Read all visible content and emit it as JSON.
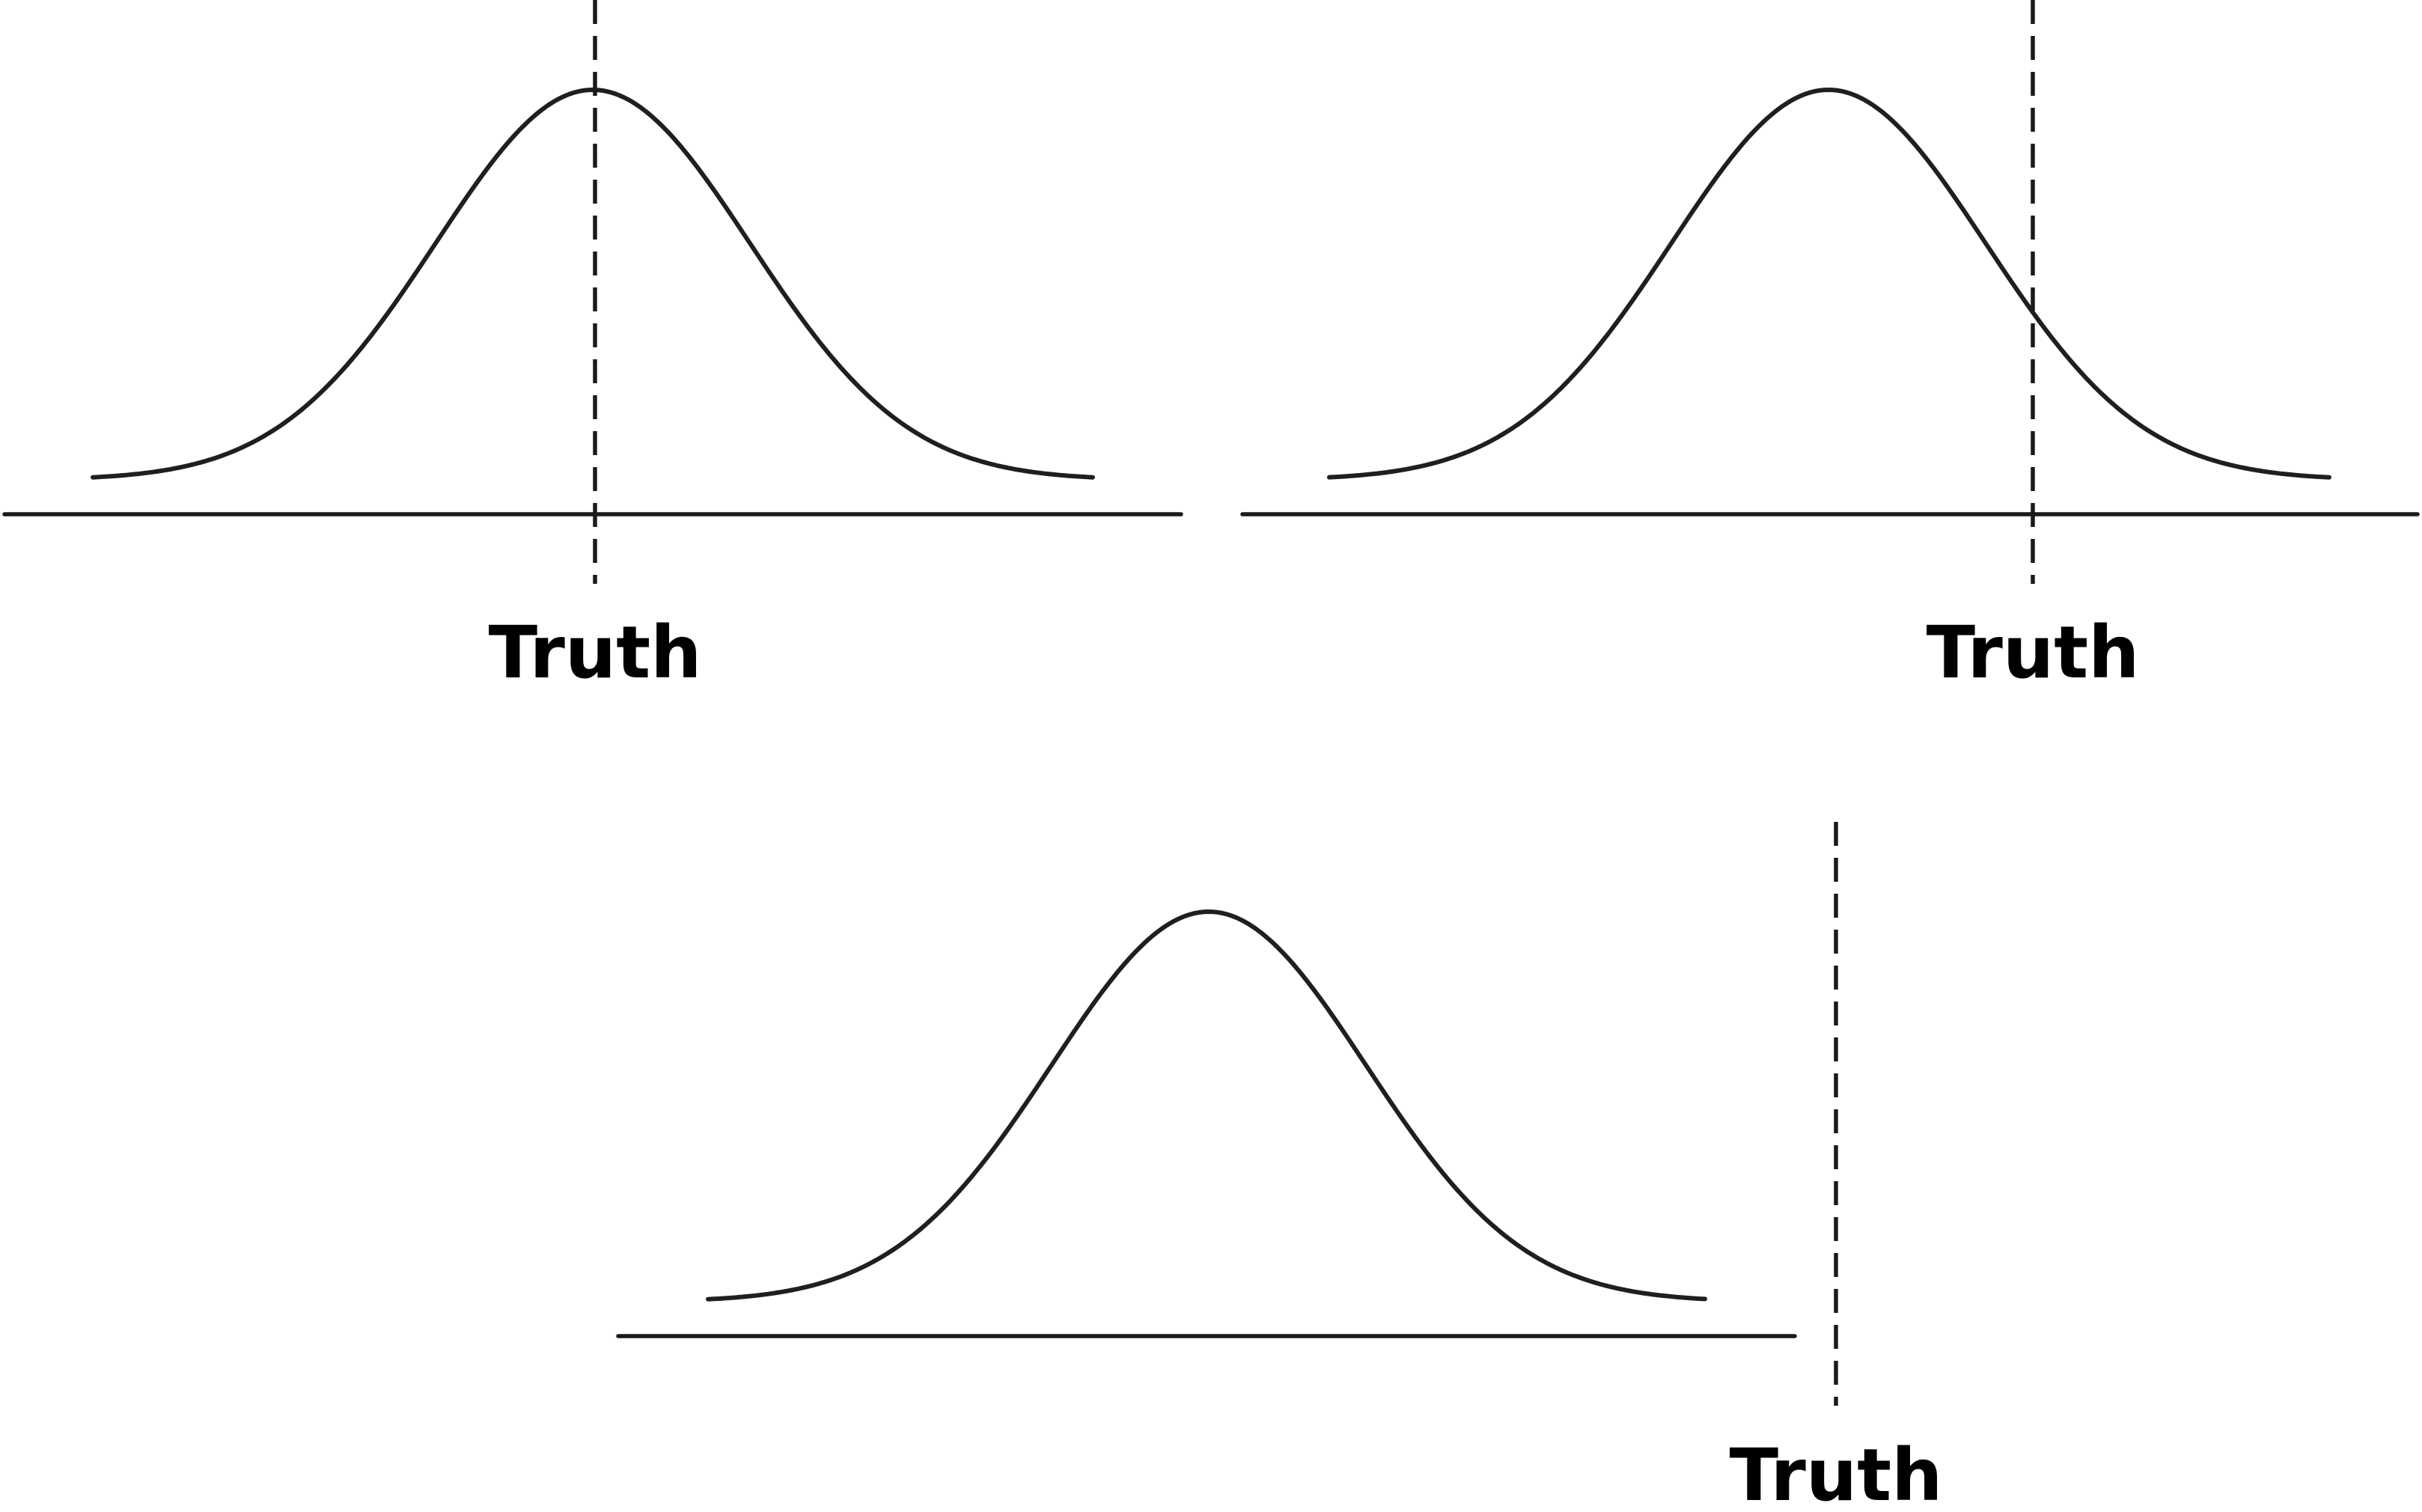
{
  "panels": [
    {
      "id": "top-left",
      "truth_label": "Truth"
    },
    {
      "id": "top-right",
      "truth_label": "Truth"
    },
    {
      "id": "bottom-center",
      "truth_label": "Truth"
    }
  ]
}
